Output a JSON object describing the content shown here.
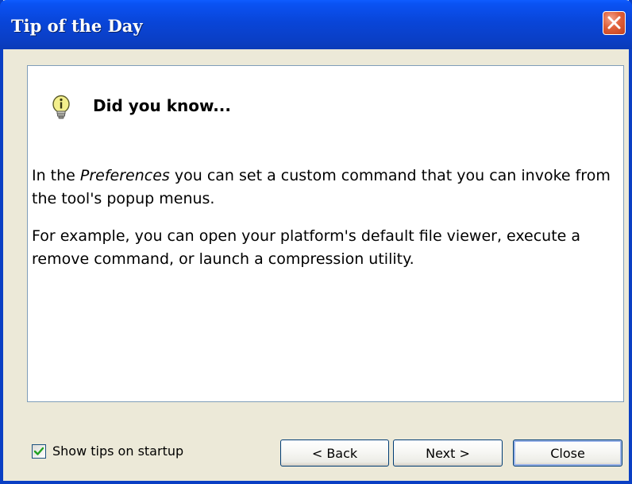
{
  "window": {
    "title": "Tip of the Day"
  },
  "icons": {
    "close": "close-icon",
    "tip": "lightbulb-info-icon",
    "check": "checkmark-icon"
  },
  "colors": {
    "titlebar": "#0945d8",
    "close_button": "#e0603a",
    "dialog_bg": "#ece9d8",
    "panel_border": "#7f9db9",
    "checkbox_check": "#21a121"
  },
  "tip": {
    "heading": "Did you know...",
    "p1_before": "In the ",
    "p1_em": "Preferences",
    "p1_after": " you can set a custom command that you can invoke from the tool's popup menus.",
    "p2": "For example, you can open your platform's default file viewer, execute a remove command, or launch a compression utility."
  },
  "footer": {
    "show_tips_label": "Show tips on startup",
    "show_tips_checked": true,
    "back_label": "< Back",
    "next_label": "Next >",
    "close_label": "Close"
  }
}
